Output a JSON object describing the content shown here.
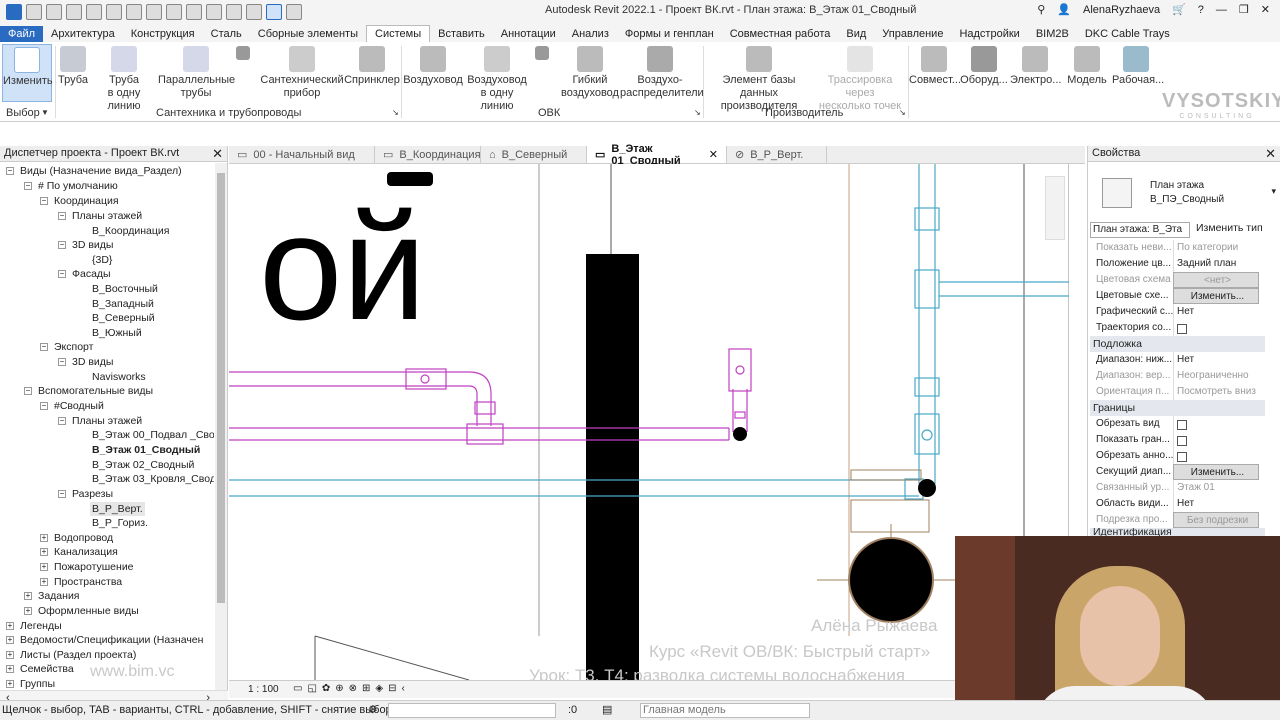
{
  "app_title": "Autodesk Revit 2022.1 - Проект ВК.rvt - План этажа: В_Этаж 01_Сводный",
  "user": "AlenaRyzhaeva",
  "menu_tabs": [
    "Файл",
    "Архитектура",
    "Конструкция",
    "Сталь",
    "Сборные элементы",
    "Системы",
    "Вставить",
    "Аннотации",
    "Анализ",
    "Формы и генплан",
    "Совместная работа",
    "Вид",
    "Управление",
    "Надстройки",
    "BIM2B",
    "DKC Cable Trays"
  ],
  "ribbon": {
    "modify": "Изменить",
    "pipe": "Труба",
    "parallel_line": "Труба\nв одну линию",
    "parallel_pipes": "Параллельные\nтрубы",
    "plumbing": "Сантехнический\nприбор",
    "sprinkler": "Спринклер",
    "duct": "Воздуховод",
    "duct_line": "Воздуховод\nв одну линию",
    "flex_duct": "Гибкий\nвоздуховод",
    "air_terminal": "Воздухо-\nраспределители",
    "mfr_part": "Элемент базы данных\nпроизводителя",
    "route_points": "Трассировка через\nнесколько точек",
    "coord": "Совмест...",
    "equipment": "Оборуд...",
    "electro": "Электро...",
    "model": "Модель",
    "workplane": "Рабочая...",
    "panels": {
      "select": "Выбор",
      "plumbing": "Сантехника и трубопроводы",
      "hvac": "ОВК",
      "fabrication": "Производитель"
    }
  },
  "logo": {
    "name": "VYSOTSKIY",
    "sub": "CONSULTING"
  },
  "project_browser": {
    "title": "Диспетчер проекта - Проект ВК.rvt",
    "nodes": [
      "Виды (Назначение вида_Раздел)",
      "# По умолчанию",
      "Координация",
      "Планы этажей",
      "В_Координация",
      "3D виды",
      "{3D}",
      "Фасады",
      "В_Восточный",
      "В_Западный",
      "В_Северный",
      "В_Южный",
      "Экспорт",
      "3D виды",
      "Navisworks",
      "Вспомогательные виды",
      "#Сводный",
      "Планы этажей",
      "В_Этаж 00_Подвал _Сводн",
      "В_Этаж 01_Сводный",
      "В_Этаж 02_Сводный",
      "В_Этаж 03_Кровля_Сводны",
      "Разрезы",
      "В_Р_Верт.",
      "В_Р_Гориз.",
      "Водопровод",
      "Канализация",
      "Пожаротушение",
      "Пространства",
      "Задания",
      "Оформленные виды",
      "Легенды",
      "Ведомости/Спецификации (Назначен",
      "Листы (Раздел проекта)",
      "Семейства",
      "Группы"
    ],
    "site": "www.bim.vc"
  },
  "view_tabs": [
    "00 - Начальный вид",
    "В_Координация",
    "В_Северный",
    "В_Этаж 01_Сводный",
    "В_Р_Верт."
  ],
  "canvas": {
    "room_text": "ой",
    "author": "Алёна Рыжаева",
    "course": "Курс «Revit ОВ/ВК: Быстрый старт»",
    "lesson": "Урок: Т3. Т4: разводка системы водоснабжения"
  },
  "scale": "1 : 100",
  "properties": {
    "title": "Свойства",
    "family": "План этажа",
    "type": "В_ПЭ_Сводный",
    "selector": "План этажа: В_Эта",
    "edit_type": "Изменить тип",
    "rows1": [
      [
        "Показать неви...",
        "По категории"
      ],
      [
        "Положение цв...",
        "Задний план"
      ],
      [
        "Цветовая схема",
        "<нет>"
      ],
      [
        "Цветовые схе...",
        "Изменить..."
      ],
      [
        "Графический с...",
        "Нет"
      ],
      [
        "Траектория со...",
        ""
      ]
    ],
    "underlay": "Подложка",
    "rows2": [
      [
        "Диапазон: ниж...",
        "Нет"
      ],
      [
        "Диапазон: вер...",
        "Неограниченно"
      ],
      [
        "Ориентация п...",
        "Посмотреть вниз"
      ]
    ],
    "bounds": "Границы",
    "rows3": [
      [
        "Обрезать вид",
        ""
      ],
      [
        "Показать гран...",
        ""
      ],
      [
        "Обрезать анно...",
        ""
      ],
      [
        "Секущий диап...",
        "Изменить..."
      ],
      [
        "Связанный ур...",
        "Этаж 01"
      ],
      [
        "Область види...",
        "Нет"
      ],
      [
        "Подрезка про...",
        "Без подрезки"
      ]
    ],
    "ident": "Идентификация"
  },
  "status": {
    "hint": "Щелчок - выбор, TAB - варианты, CTRL - добавление, SHIFT - снятие выбора.",
    "count": ":0",
    "model": "Главная модель"
  },
  "colors": {
    "accent": "#2a6bc2",
    "pipe_magenta": "#c040c0",
    "pipe_cyan": "#4aa8c8"
  }
}
